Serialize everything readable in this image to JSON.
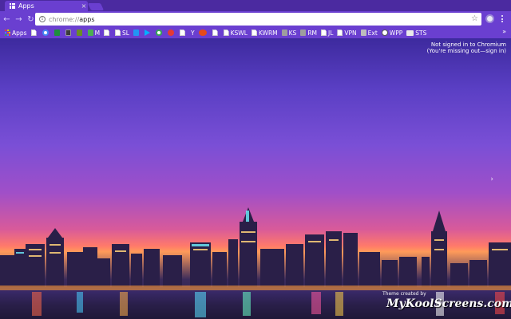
{
  "tab": {
    "title": "Apps",
    "close": "×"
  },
  "window": {
    "minimize": "–",
    "maximize": "□",
    "close": "×"
  },
  "toolbar": {
    "back": "←",
    "forward": "→",
    "reload": "↻",
    "url_scheme": "chrome://",
    "url_host": "apps",
    "star": "☆"
  },
  "bookmarks": {
    "items": [
      {
        "label": "Apps",
        "icon": "apps-grid-icon"
      },
      {
        "label": "",
        "icon": "page-icon"
      },
      {
        "label": "",
        "icon": "google-icon"
      },
      {
        "label": "",
        "icon": "bookmark-green-icon"
      },
      {
        "label": "",
        "icon": "bookmark-dark-icon"
      },
      {
        "label": "",
        "icon": "minecraft-icon"
      },
      {
        "label": "M",
        "icon": "bookmark-icon"
      },
      {
        "label": "",
        "icon": "page-icon"
      },
      {
        "label": "SL",
        "icon": "page-icon"
      },
      {
        "label": "",
        "icon": "bookmark-blue-icon"
      },
      {
        "label": "",
        "icon": "play-icon"
      },
      {
        "label": "",
        "icon": "google-icon"
      },
      {
        "label": "",
        "icon": "youtube-icon"
      },
      {
        "label": "",
        "icon": "page-icon"
      },
      {
        "label": "Y",
        "icon": "yahoo-icon"
      },
      {
        "label": "",
        "icon": "link-icon"
      },
      {
        "label": "",
        "icon": "page-icon"
      },
      {
        "label": "KSWL",
        "icon": "page-icon"
      },
      {
        "label": "KWRM",
        "icon": "page-icon"
      },
      {
        "label": "KS",
        "icon": "puzzle-icon"
      },
      {
        "label": "RM",
        "icon": "puzzle-icon"
      },
      {
        "label": "JL",
        "icon": "page-icon"
      },
      {
        "label": "VPN",
        "icon": "page-icon"
      },
      {
        "label": "Ext",
        "icon": "puzzle-icon"
      },
      {
        "label": "WPP",
        "icon": "wordpress-icon"
      },
      {
        "label": "STS",
        "icon": "folder-icon"
      }
    ],
    "more": "»"
  },
  "signin": {
    "line1": "Not signed in to Chromium",
    "line2": "(You're missing out—sign in)"
  },
  "ntp": {
    "next_arrow": "›",
    "theme_credit": "Theme created by",
    "watermark": "MyKoolScreens.com"
  },
  "colors": {
    "frame": "#4b2aa0",
    "toolbar": "#6a3fd0",
    "sky_top": "#3d2a9e",
    "sky_horizon": "#ff7a6a"
  }
}
